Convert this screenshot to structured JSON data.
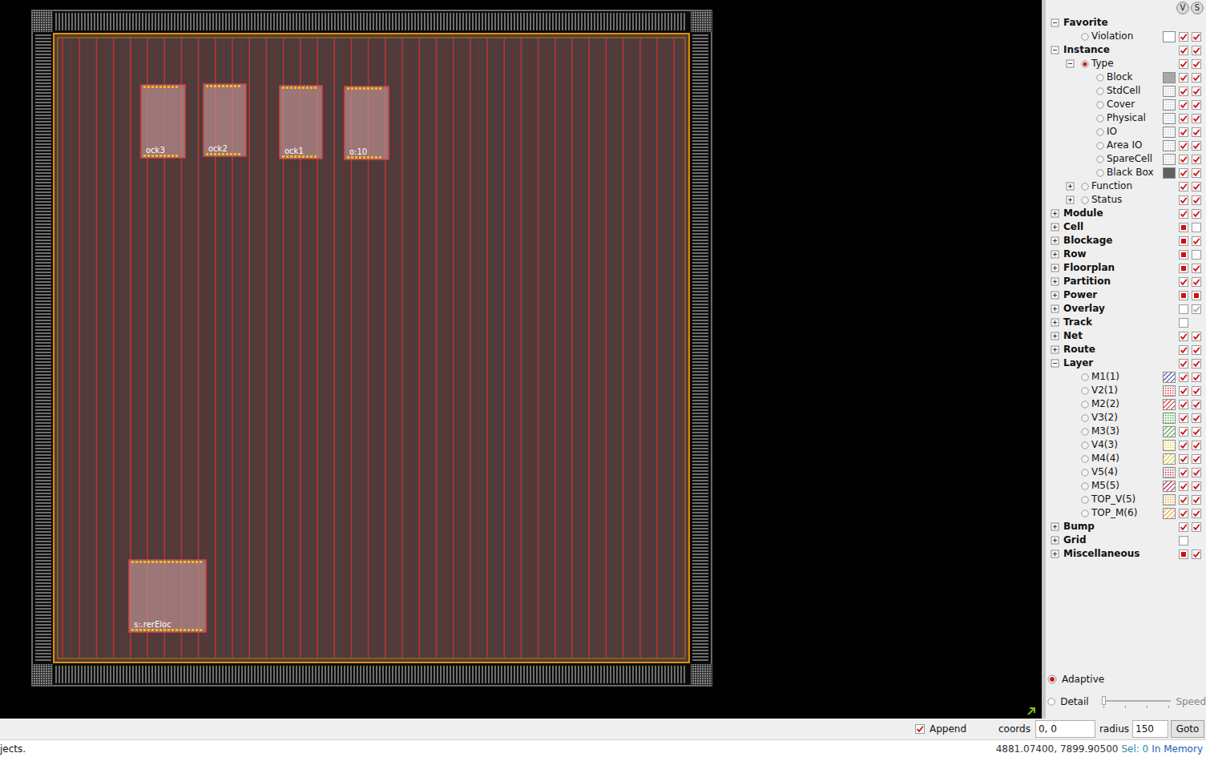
{
  "canvas": {
    "blocks": [
      {
        "label": "ock3"
      },
      {
        "label": "ock2"
      },
      {
        "label": "ock1"
      },
      {
        "label": "o:10"
      },
      {
        "label": "s:.rerEloc"
      }
    ]
  },
  "panel": {
    "header_buttons": [
      "V",
      "S"
    ],
    "rows": [
      {
        "label": "Favorite",
        "level": 0,
        "bold": true,
        "expander": "expanded",
        "radio": "none",
        "swatch": null,
        "vis": [
          "none",
          "none"
        ]
      },
      {
        "label": "Violation",
        "level": 1,
        "bold": false,
        "expander": "none",
        "radio": "unselected",
        "swatch": {
          "color": "#ffffff",
          "pattern": "solid"
        },
        "vis": [
          "checked",
          "checked"
        ]
      },
      {
        "label": "Instance",
        "level": 0,
        "bold": true,
        "expander": "expanded",
        "radio": "none",
        "swatch": null,
        "vis": [
          "checked",
          "checked"
        ]
      },
      {
        "label": "Type",
        "level": 1,
        "bold": false,
        "expander": "expanded",
        "radio": "selected",
        "swatch": null,
        "vis": [
          "checked",
          "checked"
        ]
      },
      {
        "label": "Block",
        "level": 2,
        "bold": false,
        "expander": "none",
        "radio": "unselected",
        "swatch": {
          "color": "#a8a8a8",
          "pattern": "solid"
        },
        "vis": [
          "checked",
          "checked"
        ]
      },
      {
        "label": "StdCell",
        "level": 2,
        "bold": false,
        "expander": "none",
        "radio": "unselected",
        "swatch": {
          "color": "#c8c8c8",
          "pattern": "dots"
        },
        "vis": [
          "checked",
          "checked"
        ]
      },
      {
        "label": "Cover",
        "level": 2,
        "bold": false,
        "expander": "none",
        "radio": "unselected",
        "swatch": {
          "color": "#c8c8c8",
          "pattern": "dots"
        },
        "vis": [
          "checked",
          "checked"
        ]
      },
      {
        "label": "Physical",
        "level": 2,
        "bold": false,
        "expander": "none",
        "radio": "unselected",
        "swatch": {
          "color": "#c8c8c8",
          "pattern": "dots"
        },
        "vis": [
          "checked",
          "checked"
        ]
      },
      {
        "label": "IO",
        "level": 2,
        "bold": false,
        "expander": "none",
        "radio": "unselected",
        "swatch": {
          "color": "#c8c8c8",
          "pattern": "dots"
        },
        "vis": [
          "checked",
          "checked"
        ]
      },
      {
        "label": "Area IO",
        "level": 2,
        "bold": false,
        "expander": "none",
        "radio": "unselected",
        "swatch": {
          "color": "#c8c8c8",
          "pattern": "dots"
        },
        "vis": [
          "checked",
          "checked"
        ]
      },
      {
        "label": "SpareCell",
        "level": 2,
        "bold": false,
        "expander": "none",
        "radio": "unselected",
        "swatch": {
          "color": "#c8c8c8",
          "pattern": "dots"
        },
        "vis": [
          "checked",
          "checked"
        ]
      },
      {
        "label": "Black Box",
        "level": 2,
        "bold": false,
        "expander": "none",
        "radio": "unselected",
        "swatch": {
          "color": "#606060",
          "pattern": "solid"
        },
        "vis": [
          "checked",
          "checked"
        ]
      },
      {
        "label": "Function",
        "level": 1,
        "bold": false,
        "expander": "collapsed",
        "radio": "unselected",
        "swatch": null,
        "vis": [
          "checked",
          "checked"
        ]
      },
      {
        "label": "Status",
        "level": 1,
        "bold": false,
        "expander": "collapsed",
        "radio": "unselected",
        "swatch": null,
        "vis": [
          "checked",
          "checked"
        ]
      },
      {
        "label": "Module",
        "level": 0,
        "bold": true,
        "expander": "collapsed",
        "radio": "none",
        "swatch": null,
        "vis": [
          "checked",
          "checked"
        ]
      },
      {
        "label": "Cell",
        "level": 0,
        "bold": true,
        "expander": "collapsed",
        "radio": "none",
        "swatch": null,
        "vis": [
          "partial",
          "empty"
        ]
      },
      {
        "label": "Blockage",
        "level": 0,
        "bold": true,
        "expander": "collapsed",
        "radio": "none",
        "swatch": null,
        "vis": [
          "partial",
          "checked"
        ]
      },
      {
        "label": "Row",
        "level": 0,
        "bold": true,
        "expander": "collapsed",
        "radio": "none",
        "swatch": null,
        "vis": [
          "partial",
          "empty"
        ]
      },
      {
        "label": "Floorplan",
        "level": 0,
        "bold": true,
        "expander": "collapsed",
        "radio": "none",
        "swatch": null,
        "vis": [
          "partial",
          "checked"
        ]
      },
      {
        "label": "Partition",
        "level": 0,
        "bold": true,
        "expander": "collapsed",
        "radio": "none",
        "swatch": null,
        "vis": [
          "checked",
          "checked"
        ]
      },
      {
        "label": "Power",
        "level": 0,
        "bold": true,
        "expander": "collapsed",
        "radio": "none",
        "swatch": null,
        "vis": [
          "partial",
          "partial"
        ]
      },
      {
        "label": "Overlay",
        "level": 0,
        "bold": true,
        "expander": "collapsed",
        "radio": "none",
        "swatch": null,
        "vis": [
          "empty",
          "disabled"
        ]
      },
      {
        "label": "Track",
        "level": 0,
        "bold": true,
        "expander": "collapsed",
        "radio": "none",
        "swatch": null,
        "vis": [
          "empty",
          "none"
        ]
      },
      {
        "label": "Net",
        "level": 0,
        "bold": true,
        "expander": "collapsed",
        "radio": "none",
        "swatch": null,
        "vis": [
          "checked",
          "checked"
        ]
      },
      {
        "label": "Route",
        "level": 0,
        "bold": true,
        "expander": "collapsed",
        "radio": "none",
        "swatch": null,
        "vis": [
          "checked",
          "checked"
        ]
      },
      {
        "label": "Layer",
        "level": 0,
        "bold": true,
        "expander": "expanded",
        "radio": "none",
        "swatch": null,
        "vis": [
          "checked",
          "checked"
        ]
      },
      {
        "label": "M1(1)",
        "level": 1,
        "bold": false,
        "expander": "none",
        "radio": "unselected",
        "swatch": {
          "color": "#2a3aa8",
          "pattern": "hatch"
        },
        "vis": [
          "checked",
          "checked"
        ]
      },
      {
        "label": "V2(1)",
        "level": 1,
        "bold": false,
        "expander": "none",
        "radio": "unselected",
        "swatch": {
          "color": "#d03838",
          "pattern": "dots"
        },
        "vis": [
          "checked",
          "checked"
        ]
      },
      {
        "label": "M2(2)",
        "level": 1,
        "bold": false,
        "expander": "none",
        "radio": "unselected",
        "swatch": {
          "color": "#c82020",
          "pattern": "hatch"
        },
        "vis": [
          "checked",
          "checked"
        ]
      },
      {
        "label": "V3(2)",
        "level": 1,
        "bold": false,
        "expander": "none",
        "radio": "unselected",
        "swatch": {
          "color": "#30b030",
          "pattern": "dots"
        },
        "vis": [
          "checked",
          "checked"
        ]
      },
      {
        "label": "M3(3)",
        "level": 1,
        "bold": false,
        "expander": "none",
        "radio": "unselected",
        "swatch": {
          "color": "#30a030",
          "pattern": "hatch"
        },
        "vis": [
          "checked",
          "checked"
        ]
      },
      {
        "label": "V4(3)",
        "level": 1,
        "bold": false,
        "expander": "none",
        "radio": "unselected",
        "swatch": {
          "color": "#e0d830",
          "pattern": "dots"
        },
        "vis": [
          "checked",
          "checked"
        ]
      },
      {
        "label": "M4(4)",
        "level": 1,
        "bold": false,
        "expander": "none",
        "radio": "unselected",
        "swatch": {
          "color": "#d8c820",
          "pattern": "hatch"
        },
        "vis": [
          "checked",
          "checked"
        ]
      },
      {
        "label": "V5(4)",
        "level": 1,
        "bold": false,
        "expander": "none",
        "radio": "unselected",
        "swatch": {
          "color": "#b03050",
          "pattern": "dots"
        },
        "vis": [
          "checked",
          "checked"
        ]
      },
      {
        "label": "M5(5)",
        "level": 1,
        "bold": false,
        "expander": "none",
        "radio": "unselected",
        "swatch": {
          "color": "#a01040",
          "pattern": "hatch"
        },
        "vis": [
          "checked",
          "checked"
        ]
      },
      {
        "label": "TOP_V(5)",
        "level": 1,
        "bold": false,
        "expander": "none",
        "radio": "unselected",
        "swatch": {
          "color": "#e8a020",
          "pattern": "dots"
        },
        "vis": [
          "checked",
          "checked"
        ]
      },
      {
        "label": "TOP_M(6)",
        "level": 1,
        "bold": false,
        "expander": "none",
        "radio": "unselected",
        "swatch": {
          "color": "#e89820",
          "pattern": "hatch"
        },
        "vis": [
          "checked",
          "checked"
        ]
      },
      {
        "label": "Bump",
        "level": 0,
        "bold": true,
        "expander": "collapsed",
        "radio": "none",
        "swatch": null,
        "vis": [
          "checked",
          "checked"
        ]
      },
      {
        "label": "Grid",
        "level": 0,
        "bold": true,
        "expander": "collapsed",
        "radio": "none",
        "swatch": null,
        "vis": [
          "empty",
          "none"
        ]
      },
      {
        "label": "Miscellaneous",
        "level": 0,
        "bold": true,
        "expander": "collapsed",
        "radio": "none",
        "swatch": null,
        "vis": [
          "partial",
          "checked"
        ]
      }
    ],
    "display_modes": [
      {
        "label": "Adaptive",
        "selected": true
      },
      {
        "label": "Detail",
        "selected": false
      }
    ],
    "slider": {
      "label": "Speed",
      "level": 0
    }
  },
  "toolbar": {
    "append": {
      "label": "Append",
      "checked": true
    },
    "coords_label": "coords",
    "coords": "0, 0",
    "radius_label": "radius",
    "radius": "150",
    "goto": "Goto"
  },
  "status_bar": {
    "message": "jects.",
    "position": "4881.07400, 7899.90500",
    "selection": "Sel: 0",
    "memory": "In Memory"
  }
}
